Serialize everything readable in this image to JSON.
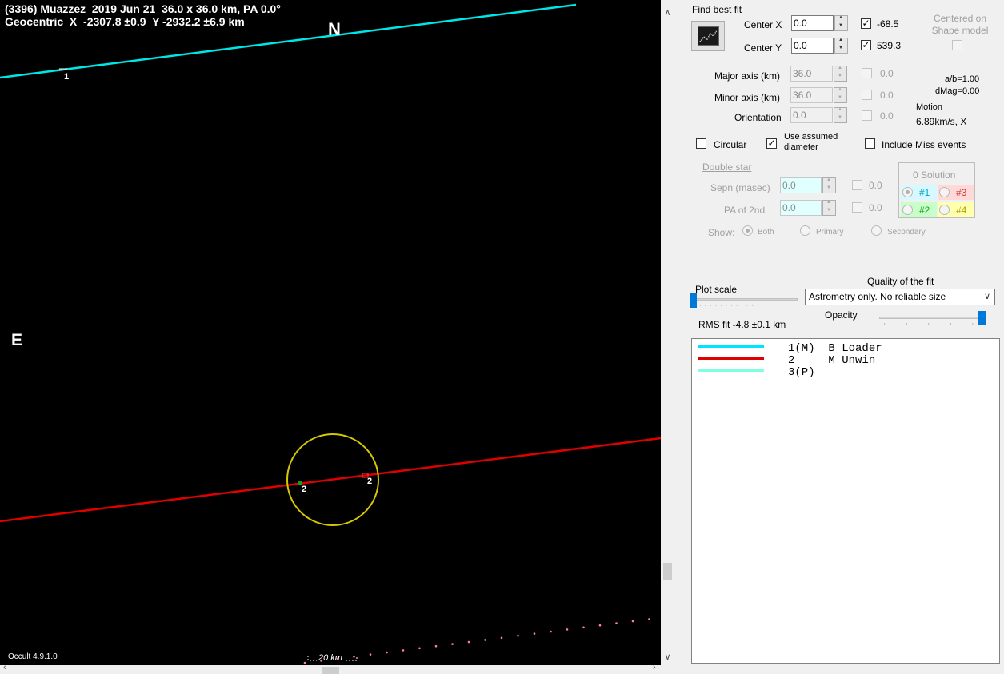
{
  "plot": {
    "title_line1": "(3396) Muazzez  2019 Jun 21  36.0 x 36.0 km, PA 0.0°",
    "title_line2": "Geocentric  X  -2307.8 ±0.9  Y -2932.2 ±6.9 km",
    "north": "N",
    "east": "E",
    "version": "Occult 4.9.1.0",
    "scale_label": "20 km",
    "chord_labels": [
      "1",
      "2",
      "2"
    ],
    "colors": {
      "chord1": "#00e5e5",
      "chord2": "#e00000",
      "ellipse": "#d4c800",
      "path": "#ff7fa0",
      "background": "#000000"
    }
  },
  "panel": {
    "find_best_fit": "Find best fit",
    "center_x_label": "Center X",
    "center_x_value": "0.0",
    "center_x_check": "-68.5",
    "center_y_label": "Center Y",
    "center_y_value": "0.0",
    "center_y_check": "539.3",
    "centered_on_shape": "Centered on Shape model",
    "major_label": "Major axis (km)",
    "major_value": "36.0",
    "major_check": "0.0",
    "minor_label": "Minor axis (km)",
    "minor_value": "36.0",
    "minor_check": "0.0",
    "orient_label": "Orientation",
    "orient_value": "0.0",
    "orient_check": "0.0",
    "ab": "a/b=1.00",
    "dmag": "dMag=0.00",
    "motion_label": "Motion",
    "motion_value": "6.89km/s, X",
    "circular": "Circular",
    "use_assumed": "Use assumed diameter",
    "include_miss": "Include Miss events",
    "double_star": "Double star",
    "sepn_label": "Sepn (masec)",
    "sepn_value": "0.0",
    "sepn_check": "0.0",
    "pa2_label": "PA of 2nd",
    "pa2_value": "0.0",
    "pa2_check": "0.0",
    "solution_title": "0 Solution",
    "sol1": "#1",
    "sol2": "#2",
    "sol3": "#3",
    "sol4": "#4",
    "show_label": "Show:",
    "show_both": "Both",
    "show_primary": "Primary",
    "show_secondary": "Secondary",
    "plot_scale": "Plot scale",
    "quality_label": "Quality of the fit",
    "quality_value": "Astrometry only. No reliable size",
    "opacity": "Opacity",
    "rms_fit": "RMS fit -4.8 ±0.1 km"
  },
  "legend": [
    {
      "text": "1(M)  B Loader",
      "color": "#00e5ff"
    },
    {
      "text": "2     M Unwin",
      "color": "#e00000"
    },
    {
      "text": "3(P)",
      "color": "#80ffe0"
    }
  ]
}
